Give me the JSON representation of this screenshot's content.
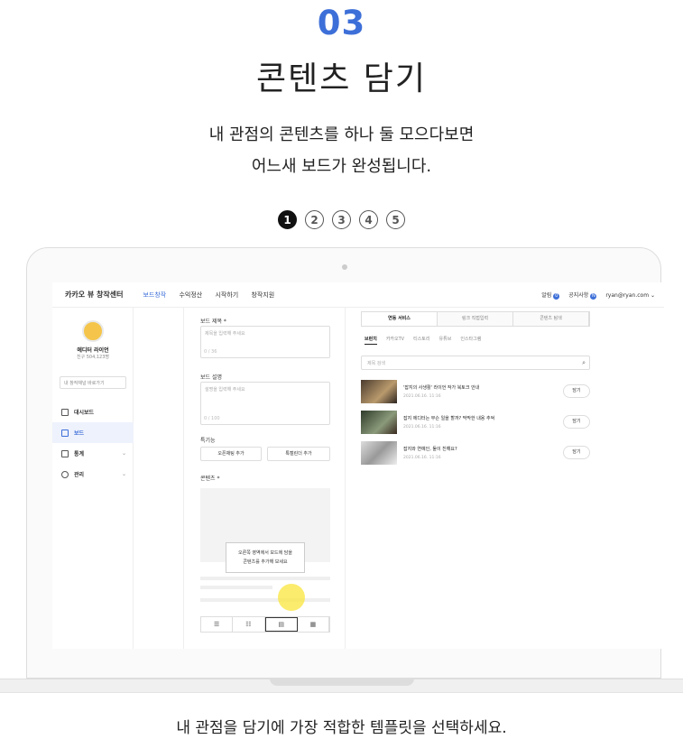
{
  "step_number": "03",
  "title": "콘텐츠 담기",
  "description_line1": "내 관점의 콘텐츠를 하나 둘 모으다보면",
  "description_line2": "어느새 보드가 완성됩니다.",
  "pager": [
    "1",
    "2",
    "3",
    "4",
    "5"
  ],
  "pager_active": "1",
  "caption": "내 관점을 담기에 가장 적합한 템플릿을 선택하세요.",
  "app": {
    "brand": "카카오 뷰 창작센터",
    "nav": [
      "보드창작",
      "수익정산",
      "시작하기",
      "창작지원"
    ],
    "top_right": {
      "alarm": "알림",
      "alarm_count": "0",
      "notice": "공지사항",
      "notice_count": "N",
      "account": "ryan@ryan.com ⌄"
    },
    "profile": {
      "name": "에디터 라이언",
      "fans": "친구 504,123명"
    },
    "channel_select": "내 창작채널 바로가기",
    "menu": [
      "대시보드",
      "보드",
      "통계",
      "관리"
    ],
    "form": {
      "title_label": "보드 제목 *",
      "title_placeholder": "제목을 입력해 주세요",
      "title_count": "0 / 36",
      "desc_label": "보드 설명",
      "desc_placeholder": "설명을 입력해 주세요",
      "desc_count": "0 / 100",
      "extra_label": "특기능",
      "btn_chat": "오픈채팅 추가",
      "btn_calendar": "톡캘린더 추가",
      "content_label": "콘텐츠 *",
      "tip_line1": "오른쪽 영역에서 보드에 담을",
      "tip_line2": "콘텐츠를 추가해 보세요",
      "templates": [
        "☰",
        "☷",
        "▤",
        "▦"
      ]
    },
    "right": {
      "tabs": [
        "연동 서비스",
        "링크 직접입력",
        "콘텐츠 탐색"
      ],
      "subtabs": [
        "브런치",
        "카카오TV",
        "티스토리",
        "유튜브",
        "인스타그램"
      ],
      "search_placeholder": "제목 검색",
      "add_label": "담기",
      "items": [
        {
          "title": "'잡지의 사생활' 라이언 작가 북토크 안내",
          "date": "2021.06.16. 11:16"
        },
        {
          "title": "잡지 에디터는 무슨 일을 할까? 막막한 내용 추억",
          "date": "2021.06.16. 11:16"
        },
        {
          "title": "잡지와 연예인, 둘이 친해요?",
          "date": "2021.06.16. 11:16"
        }
      ]
    }
  }
}
